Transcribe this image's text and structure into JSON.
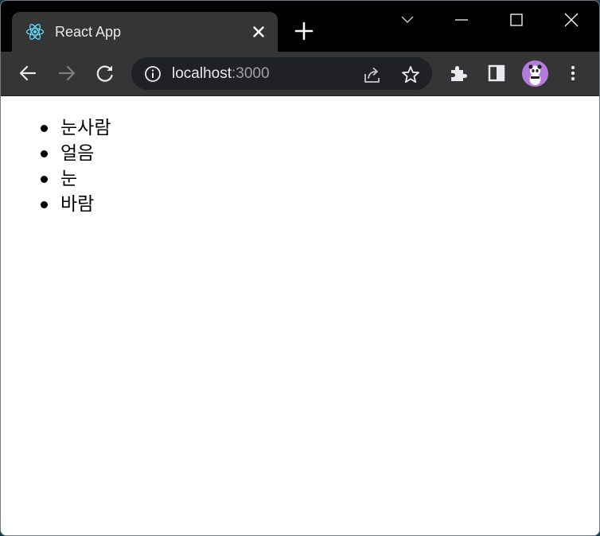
{
  "browser": {
    "tab": {
      "title": "React App",
      "favicon": "react-logo-icon"
    },
    "address_bar": {
      "host": "localhost",
      "port": ":3000"
    },
    "colors": {
      "tabstrip": "#000000",
      "toolbar": "#353535",
      "omnibox": "#202124",
      "avatar": "#b37be0",
      "react": "#61dafb"
    }
  },
  "page": {
    "items": [
      {
        "label": "눈사람"
      },
      {
        "label": "얼음"
      },
      {
        "label": "눈"
      },
      {
        "label": "바람"
      }
    ]
  }
}
